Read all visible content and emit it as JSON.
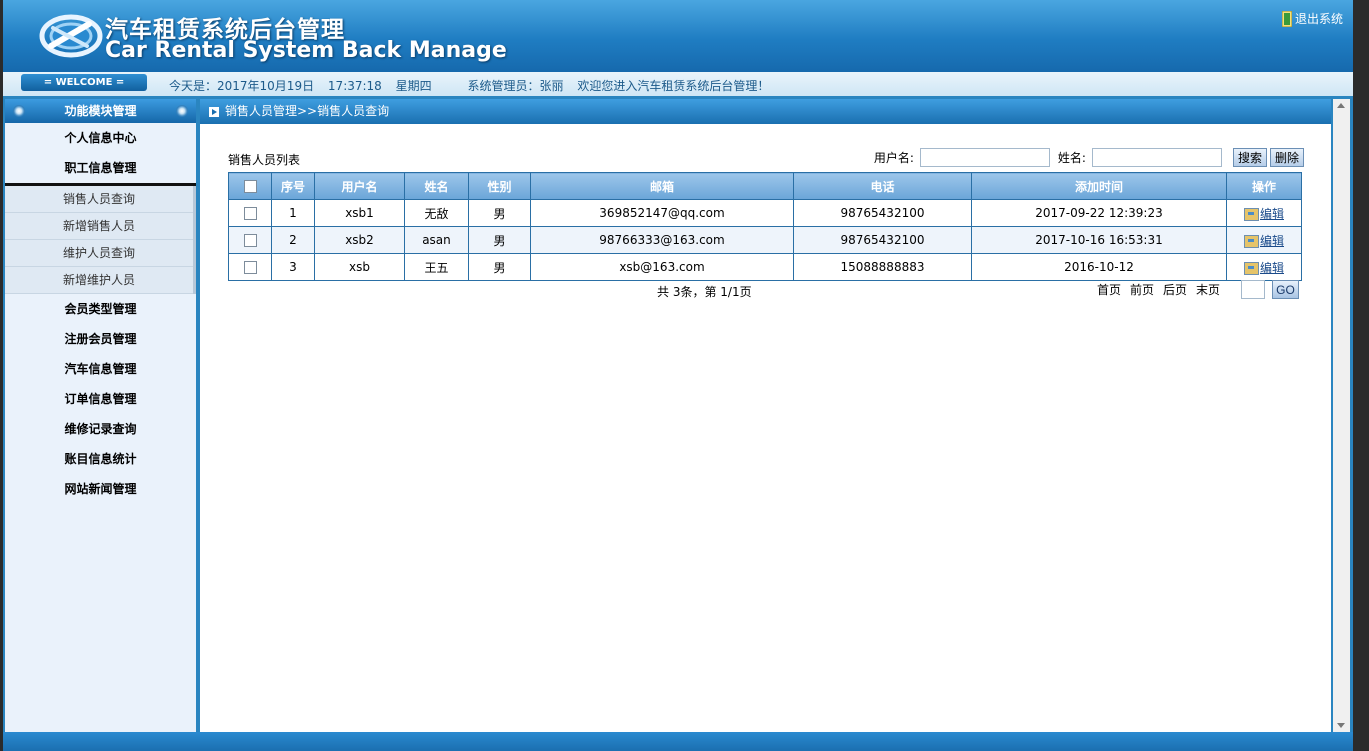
{
  "header": {
    "title_cn": "汽车租赁系统后台管理",
    "title_en": "Car Rental System Back Manage",
    "logout_label": "退出系统"
  },
  "infobar": {
    "welcome": "= WELCOME =",
    "date": "今天是：2017年10月19日",
    "time": "17:37:18",
    "weekday": "星期四",
    "admin": "系统管理员：张丽",
    "greeting": "欢迎您进入汽车租赁系统后台管理！"
  },
  "sidebar": {
    "header": "功能模块管理",
    "items_top": [
      "个人信息中心",
      "职工信息管理"
    ],
    "sub_items": [
      "销售人员查询",
      "新增销售人员",
      "维护人员查询",
      "新增维护人员"
    ],
    "items_bottom": [
      "会员类型管理",
      "注册会员管理",
      "汽车信息管理",
      "订单信息管理",
      "维修记录查询",
      "账目信息统计",
      "网站新闻管理"
    ]
  },
  "main": {
    "breadcrumb": "销售人员管理>>销售人员查询",
    "list_title": "销售人员列表",
    "search": {
      "username_label": "用户名:",
      "username_value": "",
      "name_label": "姓名:",
      "name_value": "",
      "search_button": "搜索",
      "delete_button": "删除"
    },
    "table": {
      "columns": [
        "序号",
        "用户名",
        "姓名",
        "性别",
        "邮箱",
        "电话",
        "添加时间",
        "操作"
      ],
      "rows": [
        {
          "no": "1",
          "username": "xsb1",
          "name": "无敌",
          "gender": "男",
          "email": "369852147@qq.com",
          "phone": "98765432100",
          "added": "2017-09-22 12:39:23",
          "action": "编辑"
        },
        {
          "no": "2",
          "username": "xsb2",
          "name": "asan",
          "gender": "男",
          "email": "98766333@163.com",
          "phone": "98765432100",
          "added": "2017-10-16 16:53:31",
          "action": "编辑"
        },
        {
          "no": "3",
          "username": "xsb",
          "name": "王五",
          "gender": "男",
          "email": "xsb@163.com",
          "phone": "15088888883",
          "added": "2016-10-12",
          "action": "编辑"
        }
      ]
    },
    "pager": {
      "summary": "共 3条，第 1/1页",
      "first": "首页",
      "prev": "前页",
      "next": "后页",
      "last": "末页",
      "page_value": "",
      "go_button": "GO"
    }
  }
}
